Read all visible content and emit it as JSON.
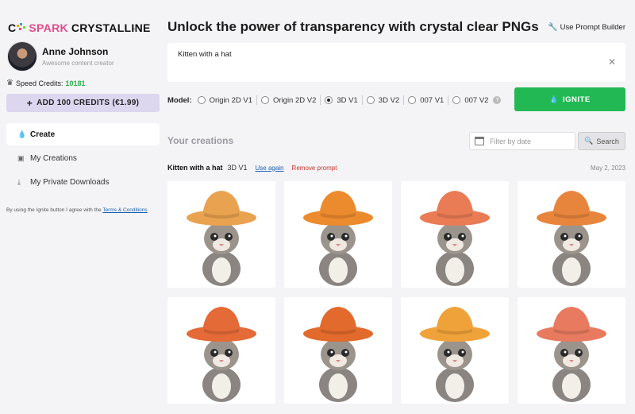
{
  "brand": {
    "part1": "C",
    "part2": "SPARK",
    "part3": "CRYSTALLINE"
  },
  "profile": {
    "name": "Anne Johnson",
    "role": "Awesome content creator"
  },
  "credits": {
    "label": "Speed Credits:",
    "value": "10181",
    "add_button": "ADD 100 CREDITS (€1.99)"
  },
  "nav": {
    "items": [
      {
        "label": "Create",
        "icon": "drop-icon"
      },
      {
        "label": "My Creations",
        "icon": "images-icon"
      },
      {
        "label": "My Private Downloads",
        "icon": "download-icon"
      }
    ]
  },
  "terms": {
    "text": "By using the Ignite button I agree with the",
    "link": "Terms & Conditions"
  },
  "header": {
    "title": "Unlock the power of transparency with crystal clear PNGs",
    "prompt_builder": "Use Prompt Builder"
  },
  "prompt": {
    "value": "Kitten with a hat"
  },
  "model": {
    "label": "Model:",
    "options": [
      "Origin 2D V1",
      "Origin 2D V2",
      "3D V1",
      "3D V2",
      "007 V1",
      "007 V2"
    ],
    "selected": "3D V1"
  },
  "ignite": {
    "label": "IGNITE"
  },
  "creations": {
    "title": "Your creations",
    "filter_placeholder": "Filter by date",
    "search_label": "Search"
  },
  "generation": {
    "prompt": "Kitten with a hat",
    "model": "3D V1",
    "use_again": "Use again",
    "remove": "Remove prompt",
    "date": "May 2, 2023",
    "images": [
      {
        "hat_color": "#e9a24f"
      },
      {
        "hat_color": "#ec8a2e"
      },
      {
        "hat_color": "#e97b55"
      },
      {
        "hat_color": "#e8853d"
      },
      {
        "hat_color": "#e46a37"
      },
      {
        "hat_color": "#e26a2c"
      },
      {
        "hat_color": "#f0a23a"
      },
      {
        "hat_color": "#e77a5f"
      }
    ]
  },
  "colors": {
    "accent_green": "#22b955",
    "credits_button_bg": "#ddd6ef",
    "link_blue": "#1a5fb4",
    "remove_red": "#c0392b"
  }
}
